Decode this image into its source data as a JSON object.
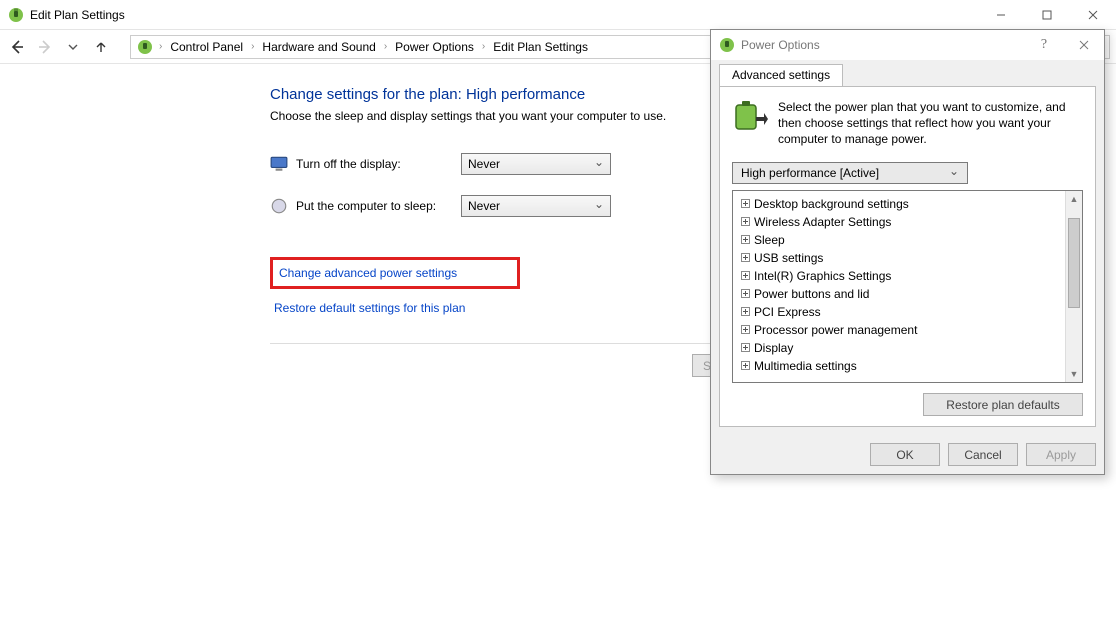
{
  "window": {
    "title": "Edit Plan Settings"
  },
  "breadcrumb": {
    "items": [
      "Control Panel",
      "Hardware and Sound",
      "Power Options",
      "Edit Plan Settings"
    ]
  },
  "plan": {
    "heading": "Change settings for the plan: High performance",
    "sub": "Choose the sleep and display settings that you want your computer to use.",
    "display_label": "Turn off the display:",
    "display_value": "Never",
    "sleep_label": "Put the computer to sleep:",
    "sleep_value": "Never",
    "adv_link": "Change advanced power settings",
    "restore_link": "Restore default settings for this plan",
    "save_button": "Save changes"
  },
  "dialog": {
    "title": "Power Options",
    "tab": "Advanced settings",
    "intro": "Select the power plan that you want to customize, and then choose settings that reflect how you want your computer to manage power.",
    "combo": "High performance [Active]",
    "tree": [
      "Desktop background settings",
      "Wireless Adapter Settings",
      "Sleep",
      "USB settings",
      "Intel(R) Graphics Settings",
      "Power buttons and lid",
      "PCI Express",
      "Processor power management",
      "Display",
      "Multimedia settings"
    ],
    "restore_btn": "Restore plan defaults",
    "ok": "OK",
    "cancel": "Cancel",
    "apply": "Apply"
  }
}
